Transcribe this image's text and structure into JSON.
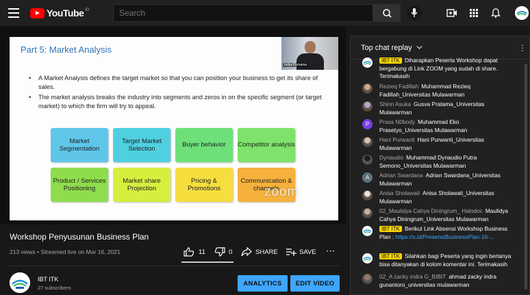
{
  "header": {
    "logo_text": "YouTube",
    "region": "ID",
    "search_placeholder": "Search"
  },
  "slide": {
    "title": "Part 5: Market Analysis",
    "speaker_name": "Indra Purnama",
    "bullets": [
      "A Market Analysis defines the target market so that you can position your business to get its share of sales.",
      "The market analysis breaks the industry into segments and zeros in on the specific segment (or target market) to which the firm will try to appeal."
    ],
    "boxes": [
      {
        "label": "Market Segmentation",
        "color": "#5fc6ea"
      },
      {
        "label": "Target Market Selection",
        "color": "#4fd0e0"
      },
      {
        "label": "Buyer behavior",
        "color": "#6ee07a"
      },
      {
        "label": "Competitor analysis",
        "color": "#7ee36a"
      },
      {
        "label": "Product / Services Positioning",
        "color": "#8fdc4d"
      },
      {
        "label": "Market share Projection",
        "color": "#d6ee3e"
      },
      {
        "label": "Pricing & Promotions",
        "color": "#f6de3e"
      },
      {
        "label": "Communication & channels",
        "color": "#f6b03c"
      }
    ],
    "watermark": "zoom"
  },
  "video": {
    "title": "Workshop Penyusunan Business Plan",
    "meta": "213 views • Streamed live on Mar 16, 2021",
    "likes": "11",
    "dislikes": "0",
    "share_label": "SHARE",
    "save_label": "SAVE",
    "like_ratio": 1.0
  },
  "channel": {
    "name": "IBT ITK",
    "subscribers": "27 subscribers",
    "analytics_label": "ANALYTICS",
    "edit_label": "EDIT VIDEO"
  },
  "chat": {
    "title": "Top chat replay",
    "messages": [
      {
        "author": "IBT ITK",
        "owner": true,
        "text": "Diharapkan Peserta Workshop dapat bergabung di Link ZOOM yang sudah di share. Terimakasih",
        "avatar": "ibt",
        "color": "#ffffff"
      },
      {
        "author": "Rezieq Fadillah",
        "text": "Muhammad Rezieq Fadillah_Universitas Mulawarman",
        "avatar": "photo",
        "color": "#c9a98a"
      },
      {
        "author": "Shinn Asuka",
        "text": "Gusva Pratama_Universitas Mulawarman",
        "avatar": "photo",
        "color": "#b9a3d6"
      },
      {
        "author": "Prass N0body",
        "text": "Muhammad Eko Prasetyo_Universitas Mulawarman",
        "avatar": "P",
        "color": "#7b3fe4"
      },
      {
        "author": "Hani Purwanti",
        "text": "Hani Purwanti_Universitas Mulawarman",
        "avatar": "photo",
        "color": "#d8c4b8"
      },
      {
        "author": "Dynaudio",
        "text": "Muhammad Dynaudio Putra Semono_Universitas Mulawarman",
        "avatar": "photo",
        "color": "#1b1b1b"
      },
      {
        "author": "Adrian Swardana",
        "text": "Adrian Swardana_Universitas Mulawarman",
        "avatar": "A",
        "color": "#5f7380"
      },
      {
        "author": "Anisa Sholawati",
        "text": "Anisa Sholawati_Universitas Mulawarman",
        "avatar": "photo",
        "color": "#e8e2da"
      },
      {
        "author": "02_Maulidya Cahya Diningrum_ Halodoc",
        "text": "Maulidya Cahya Diningrum_Universitas Mulawarman",
        "avatar": "photo",
        "color": "#c4b19e"
      },
      {
        "author": "IBT ITK",
        "owner": true,
        "text": "Berikut Link Absensi Workshop Business Plan :",
        "link": "https://s.id/PresensiBusinessPlan-16-...",
        "avatar": "ibt",
        "color": "#ffffff"
      },
      {
        "author": "IBT ITK",
        "owner": true,
        "text": "Silahkan bagi Peserta yang ingin bertanya bisa ditanyakan di kolom komentar ini. Terimakasih",
        "avatar": "ibt",
        "color": "#ffffff"
      },
      {
        "author": "02_A zacky indra G_BIBIT",
        "text": "ahmad zacky indra gunantoro_universitas mulawarman",
        "avatar": "photo",
        "color": "#8d7a6b"
      }
    ]
  }
}
